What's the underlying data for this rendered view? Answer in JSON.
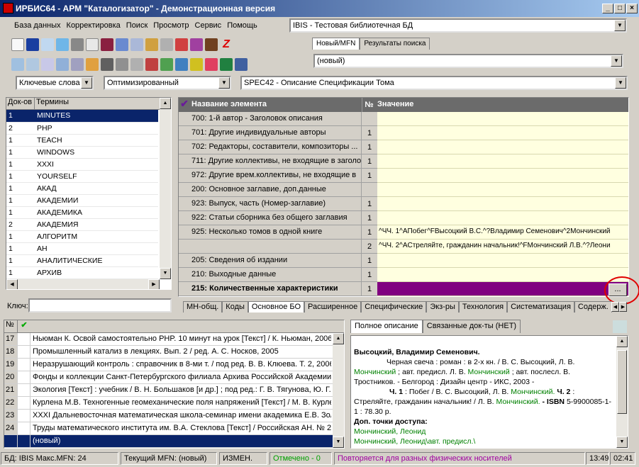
{
  "window": {
    "title": "ИРБИС64 - АРМ \"Каталогизатор\" - Демонстрационная версия"
  },
  "menu": [
    "База данных",
    "Корректировка",
    "Поиск",
    "Просмотр",
    "Сервис",
    "Помощь"
  ],
  "db_select": "IBIS - Тестовая библиотечная БД",
  "mfn_tabs": [
    "Новый/MFN",
    "Результаты поиска"
  ],
  "mfn_value": "(новый)",
  "search": {
    "mode": "Ключевые слова",
    "method": "Оптимизированный",
    "worksheet": "SPEC42 - Описание Спецификации Тома"
  },
  "terms": {
    "col_count": "Док-ов",
    "col_term": "Термины",
    "rows": [
      [
        "1",
        "MINUTES"
      ],
      [
        "2",
        "PHP"
      ],
      [
        "1",
        "TEACH"
      ],
      [
        "1",
        "WINDOWS"
      ],
      [
        "1",
        "XXXI"
      ],
      [
        "1",
        "YOURSELF"
      ],
      [
        "1",
        "АКАД"
      ],
      [
        "1",
        "АКАДЕМИИ"
      ],
      [
        "1",
        "АКАДЕМИКА"
      ],
      [
        "2",
        "АКАДЕМИЯ"
      ],
      [
        "1",
        "АЛГОРИТМ"
      ],
      [
        "1",
        "АН"
      ],
      [
        "1",
        "АНАЛИТИЧЕСКИЕ"
      ],
      [
        "1",
        "АРХИВ"
      ]
    ],
    "key_label": "Ключ:"
  },
  "grid": {
    "col_name": "Название элемента",
    "col_no": "№",
    "col_value": "Значение",
    "rows": [
      {
        "name": "700: 1-й автор - Заголовок описания",
        "no": "",
        "val": ""
      },
      {
        "name": "701: Другие индивидуальные авторы",
        "no": "1",
        "val": ""
      },
      {
        "name": "702: Редакторы, составители, композиторы ...",
        "no": "1",
        "val": ""
      },
      {
        "name": "711: Другие коллективы, не входящие в заголо",
        "no": "1",
        "val": ""
      },
      {
        "name": "972: Другие врем.коллективы, не входящие в",
        "no": "1",
        "val": ""
      },
      {
        "name": "200: Основное заглавие, доп.данные",
        "no": "",
        "val": ""
      },
      {
        "name": "923: Выпуск, часть (Номер-заглавие)",
        "no": "1",
        "val": ""
      },
      {
        "name": "922: Статьи сборника без общего заглавия",
        "no": "1",
        "val": ""
      },
      {
        "name": "925: Несколько томов в одной книге",
        "no": "1",
        "val": "^ЧЧ. 1^AПобег^FВысоцкий В.С.^?Владимир Семенович^2Мончинский"
      },
      {
        "name": "",
        "no": "2",
        "val": "^ЧЧ. 2^AСтреляйте, гражданин начальник!^FМончинский Л.В.^?Леони"
      },
      {
        "name": "205: Сведения об издании",
        "no": "1",
        "val": ""
      },
      {
        "name": "210: Выходные данные",
        "no": "1",
        "val": ""
      },
      {
        "name": "215: Количественные характеристики",
        "no": "1",
        "val": ""
      }
    ],
    "ellipsis": "..."
  },
  "sheet_tabs": [
    "МН-общ.",
    "Коды",
    "Основное БО",
    "Расширенное",
    "Специфические",
    "Экз-ры",
    "Технология",
    "Систематизация",
    "Содерж."
  ],
  "results": {
    "col_no": "№",
    "rows": [
      [
        "17",
        "Ньюман К. Освой самостоятельно PHP. 10 минут на урок [Текст] / К. Ньюман, 2006."
      ],
      [
        "18",
        "Промышленный катализ в лекциях. Вып. 2 / ред. А. С. Носков, 2005"
      ],
      [
        "19",
        "Неразрушающий контроль : справочник в 8-ми т. / под ред. В. В. Клюева. Т. 2, 2006."
      ],
      [
        "20",
        "Фонды и коллекции Санкт-Петербургского филиала Архива Российской Академии н"
      ],
      [
        "21",
        "Экология [Текст] : учебник / В. Н. Большаков [и др.] ; под ред.: Г. В. Тягунова, Ю. Г. Я"
      ],
      [
        "22",
        "Курлена М.В. Техногенные геомеханические поля напряжений [Текст] / М. В. Курлен"
      ],
      [
        "23",
        "XXXI Дальневосточная математическая школа-семинар имени академика Е.В. Золо"
      ],
      [
        "24",
        "Труды математического института им. В.А. Стеклова [Текст] / Российская АН. № 2"
      ],
      [
        "",
        "(новый)"
      ]
    ]
  },
  "desc_tabs": [
    "Полное описание",
    "Связанные док-ты (НЕТ)"
  ],
  "desc": {
    "author": "Высоцкий, Владимир Семенович.",
    "p1a": "Черная свеча : роман : в 2-х кн. / В. С. Высоцкий, Л. В.",
    "p1b": "Мончинский",
    "p1c": "; авт. предисл. Л. В.",
    "p1d": "Мончинский",
    "p1e": "; авт. послесл. В. Тростников. - Белгород : Дизайн центр - ИКС, 2003 -",
    "p2a": "Ч. 1",
    "p2b": ": Побег / В. С. Высоцкий, Л. В.",
    "p2c": "Мончинский.",
    "p2d": "Ч. 2",
    "p2e": ": Стреляйте, гражданин начальник! / Л. В.",
    "p2f": "Мончинский.",
    "p2g": "- ISBN",
    "p2h": "5-9900085-1-1 : 78.30 р.",
    "access": "Доп. точки доступа:",
    "a1": "Мончинский, Леонид",
    "a2": "Мончинский, Леонид\\авт. предисл.\\"
  },
  "status": {
    "db": "БД: IBIS Макс.MFN: 24",
    "mfn": "Текущий MFN: (новый)",
    "changed": "ИЗМЕН.",
    "marked": "Отмечено - 0",
    "hint": "Повторяется для разных физических носителей",
    "time1": "13:49",
    "time2": "02:41"
  },
  "colors": {
    "title_start": "#0a246a",
    "title_end": "#a6caf0",
    "selected": "#0a246a",
    "cell_yellow": "#ffffe0",
    "purple": "#800080",
    "green_link": "#008000"
  }
}
